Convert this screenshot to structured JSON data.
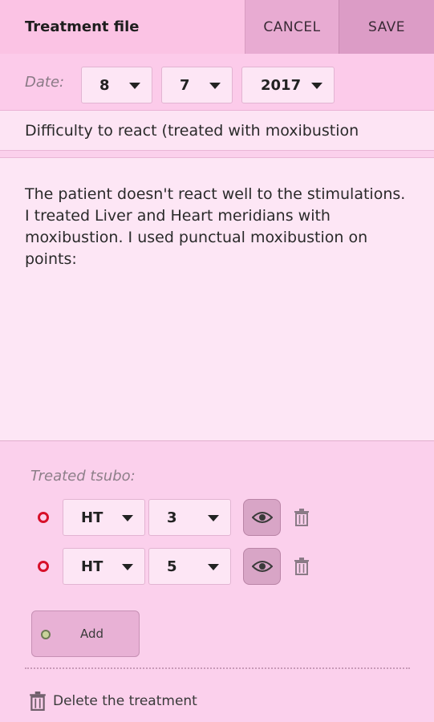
{
  "header": {
    "title": "Treatment file",
    "cancel_label": "CANCEL",
    "save_label": "SAVE"
  },
  "date": {
    "label": "Date:",
    "day": "8",
    "month": "7",
    "year": "2017"
  },
  "subject": "Difficulty to react (treated with moxibustion",
  "notes": "The patient doesn't react well to the stimulations. I treated Liver and Heart meridians with moxibustion. I used punctual moxibustion on points:",
  "tsubo": {
    "label": "Treated tsubo:",
    "rows": [
      {
        "meridian": "HT",
        "point": "3"
      },
      {
        "meridian": "HT",
        "point": "5"
      }
    ],
    "add_label": "Add"
  },
  "delete_label": "Delete the treatment",
  "icons": {
    "view": "eye-icon",
    "delete": "trash-icon",
    "dropdown": "caret-down-icon"
  },
  "colors": {
    "background": "#fbd0ec",
    "marker": "#d7102a",
    "button": "#e8b1d5"
  }
}
